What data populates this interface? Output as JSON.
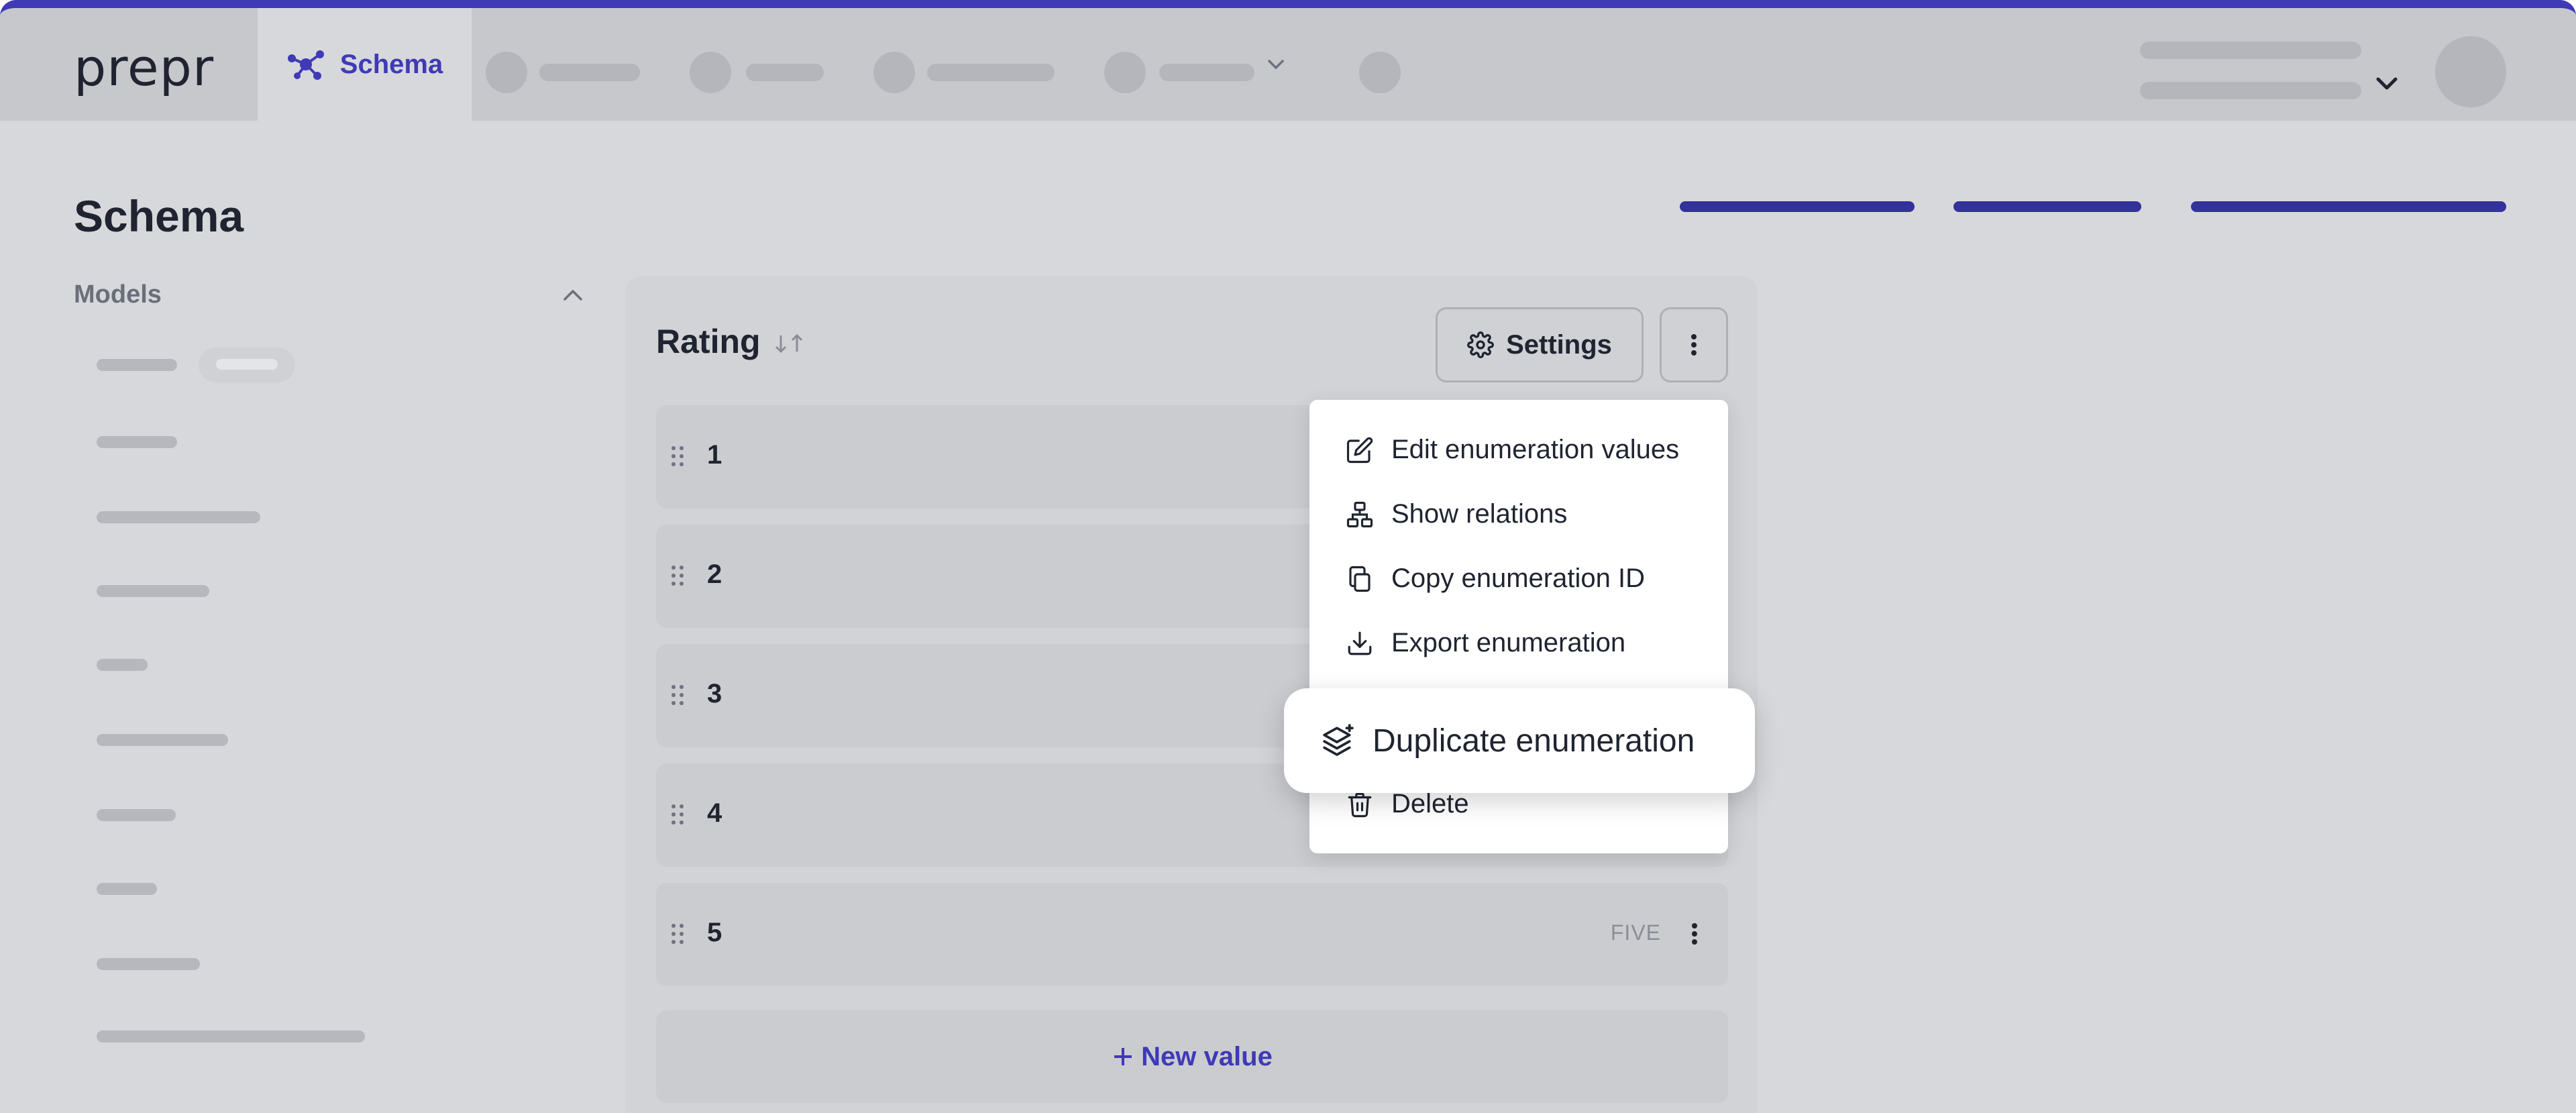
{
  "app": {
    "logo": "prepr"
  },
  "nav": {
    "active_tab": "Schema"
  },
  "page": {
    "title": "Schema"
  },
  "sidebar": {
    "section_title": "Models"
  },
  "enumeration": {
    "name": "Rating",
    "settings_label": "Settings",
    "rows": [
      {
        "value": "1",
        "key": ""
      },
      {
        "value": "2",
        "key": ""
      },
      {
        "value": "3",
        "key": ""
      },
      {
        "value": "4",
        "key": ""
      },
      {
        "value": "5",
        "key": "FIVE"
      }
    ],
    "new_value_label": "New value"
  },
  "menu": {
    "items": [
      {
        "label": "Edit enumeration values",
        "icon": "edit-icon"
      },
      {
        "label": "Show relations",
        "icon": "relations-icon"
      },
      {
        "label": "Copy enumeration ID",
        "icon": "copy-icon"
      },
      {
        "label": "Export enumeration",
        "icon": "export-icon"
      },
      {
        "label": "Duplicate enumeration",
        "icon": "duplicate-icon"
      },
      {
        "label": "Delete",
        "icon": "trash-icon"
      }
    ]
  },
  "colors": {
    "accent": "#3f3ab6",
    "top_border": "#3f3ab6"
  }
}
